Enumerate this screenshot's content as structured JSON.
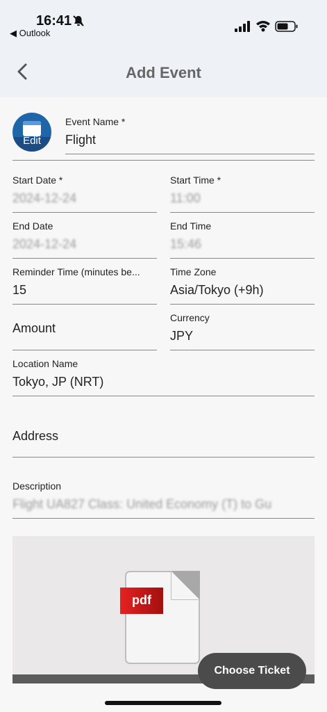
{
  "status": {
    "time": "16:41",
    "back_app": "◀ Outlook"
  },
  "header": {
    "title": "Add Event",
    "back_icon": "chevron-left-icon"
  },
  "avatar": {
    "edit_label": "Edit",
    "icon": "calendar-icon"
  },
  "form": {
    "event_name": {
      "label": "Event Name *",
      "value": "Flight"
    },
    "start_date": {
      "label": "Start Date *",
      "value": "2024-12-24"
    },
    "start_time": {
      "label": "Start Time *",
      "value": "11:00"
    },
    "end_date": {
      "label": "End Date",
      "value": "2024-12-24"
    },
    "end_time": {
      "label": "End Time",
      "value": "15:46"
    },
    "reminder": {
      "label": "Reminder Time (minutes be...",
      "value": "15"
    },
    "time_zone": {
      "label": "Time Zone",
      "value": "Asia/Tokyo (+9h)"
    },
    "amount": {
      "placeholder": "Amount"
    },
    "currency": {
      "label": "Currency",
      "value": "JPY"
    },
    "location": {
      "label": "Location Name",
      "value": "Tokyo, JP (NRT)"
    },
    "address": {
      "placeholder": "Address"
    },
    "description": {
      "label": "Description",
      "value": "Flight UA827 Class: United Economy (T) to Gu"
    }
  },
  "attachment": {
    "badge": "pdf",
    "icon": "pdf-file-icon"
  },
  "actions": {
    "choose_ticket": "Choose Ticket"
  }
}
